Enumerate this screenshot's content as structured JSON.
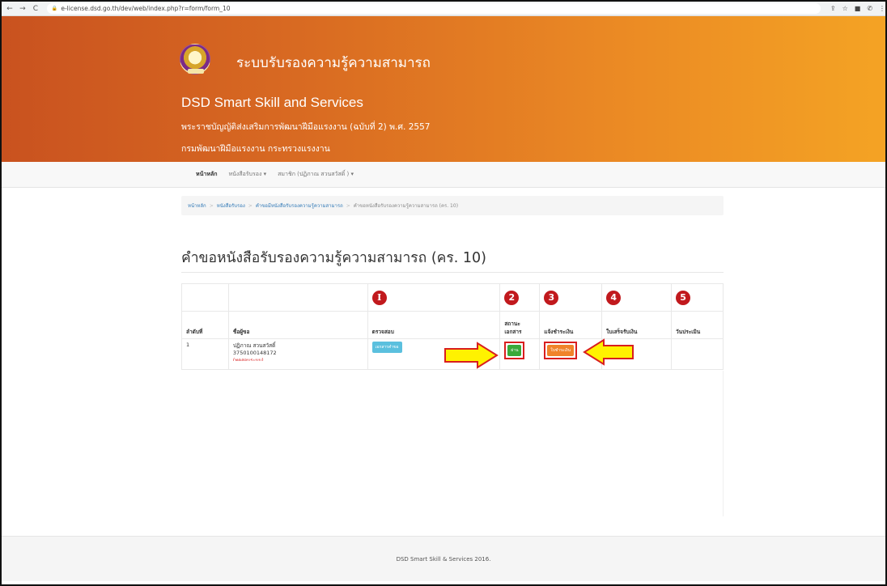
{
  "browser": {
    "url": "e-license.dsd.go.th/dev/web/index.php?r=form/form_10",
    "nav_icons": [
      "back-icon",
      "forward-icon",
      "reload-icon"
    ],
    "back_glyph": "←",
    "forward_glyph": "→",
    "reload_glyph": "C",
    "lock_glyph": "🔒",
    "ext_glyphs": [
      "⇪",
      "☆",
      "■",
      "✆",
      "⋮"
    ]
  },
  "header": {
    "system_title": "ระบบรับรองความรู้ความสามารถ",
    "brand": "DSD Smart Skill and Services",
    "act": "พระราชบัญญัติส่งเสริมการพัฒนาฝีมือแรงงาน (ฉบับที่ 2) พ.ศ. 2557",
    "department": "กรมพัฒนาฝีมือแรงงาน กระทรวงแรงงาน"
  },
  "nav": {
    "home": "หน้าหลัก",
    "certificates": "หนังสือรับรอง",
    "member": "สมาชิก (ปฏิภาณ สวนสวัสดิ์ )",
    "caret": "▾"
  },
  "breadcrumb": {
    "items": [
      "หน้าหลัก",
      "หนังสือรับรอง",
      "คำขอมีหนังสือรับรองความรู้ความสามารถ"
    ],
    "current": "คำขอหนังสือรับรองความรู้ความสามารถ (คร. 10)",
    "separator": ">"
  },
  "page_title": "คำขอหนังสือรับรองความรู้ความสามารถ (คร. 10)",
  "table": {
    "step_numbers": [
      "I",
      "2",
      "3",
      "4",
      "5"
    ],
    "headers": {
      "no": "ลำดับที่",
      "name": "ชื่อผู้ขอ",
      "check": "ตรวจสอบ",
      "status_l1": "สถานะ",
      "status_l2": "เอกสาร",
      "payment_notice": "แจ้งชำระเงิน",
      "receipt": "ใบเสร็จรับเงิน",
      "eval_date": "วันประเมิน"
    },
    "row": {
      "no": "1",
      "name": "ปฏิภาณ สวนสวัสดิ์",
      "id": "3750100148172",
      "note": "(ทดสอบระบบ)",
      "check_button": "เอกสารคำขอ",
      "status_button": "ผ่าน",
      "payment_button": "ใบชำระเงิน"
    }
  },
  "colors": {
    "step_circle": "#c1191d",
    "highlight_box": "#d91e1e",
    "arrow_fill": "#fff200",
    "arrow_stroke": "#d91e1e"
  },
  "footer": "DSD Smart Skill & Services 2016."
}
